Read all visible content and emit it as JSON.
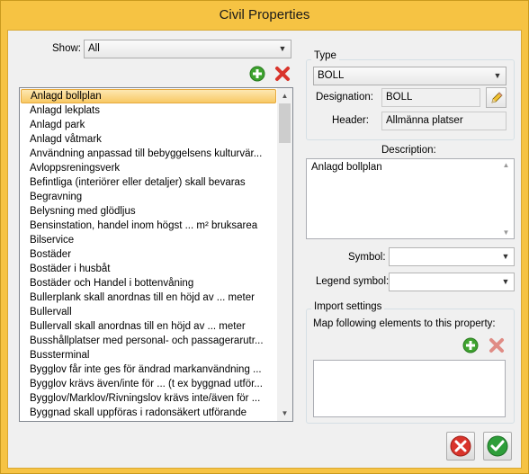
{
  "window": {
    "title": "Civil Properties"
  },
  "show": {
    "label": "Show:",
    "value": "All"
  },
  "list": {
    "items": [
      "Anlagd bollplan",
      "Anlagd lekplats",
      "Anlagd park",
      "Anlagd våtmark",
      "Användning anpassad till bebyggelsens kulturvär...",
      "Avloppsreningsverk",
      "Befintliga (interiörer eller detaljer) skall bevaras",
      "Begravning",
      "Belysning med glödljus",
      "Bensinstation, handel inom högst ... m² bruksarea",
      "Bilservice",
      "Bostäder",
      "Bostäder i husbåt",
      "Bostäder och Handel i bottenvåning",
      "Bullerplank skall anordnas till en höjd av ... meter",
      "Bullervall",
      "Bullervall skall anordnas till en höjd av ... meter",
      "Busshållplatser med personal- och passagerarutr...",
      "Bussterminal",
      "Bygglov får inte ges för ändrad markanvändning ...",
      "Bygglov krävs även/inte för ... (t ex byggnad utför...",
      "Bygglov/Marklov/Rivningslov krävs inte/även för ...",
      "Byggnad skall uppföras i radonsäkert utförande"
    ],
    "selected_index": 0
  },
  "type": {
    "group_label": "Type",
    "value": "BOLL",
    "designation_label": "Designation:",
    "designation_value": "BOLL",
    "header_label": "Header:",
    "header_value": "Allmänna platser"
  },
  "description": {
    "label": "Description:",
    "value": "Anlagd bollplan"
  },
  "symbol": {
    "label": "Symbol:",
    "value": ""
  },
  "legend_symbol": {
    "label": "Legend symbol:",
    "value": ""
  },
  "import": {
    "group_label": "Import settings",
    "map_label": "Map following elements to this property:"
  },
  "colors": {
    "window_border": "#f6c343",
    "add_green": "#3ea32f",
    "remove_red": "#d9342b",
    "ok_green": "#2e9e3a"
  }
}
